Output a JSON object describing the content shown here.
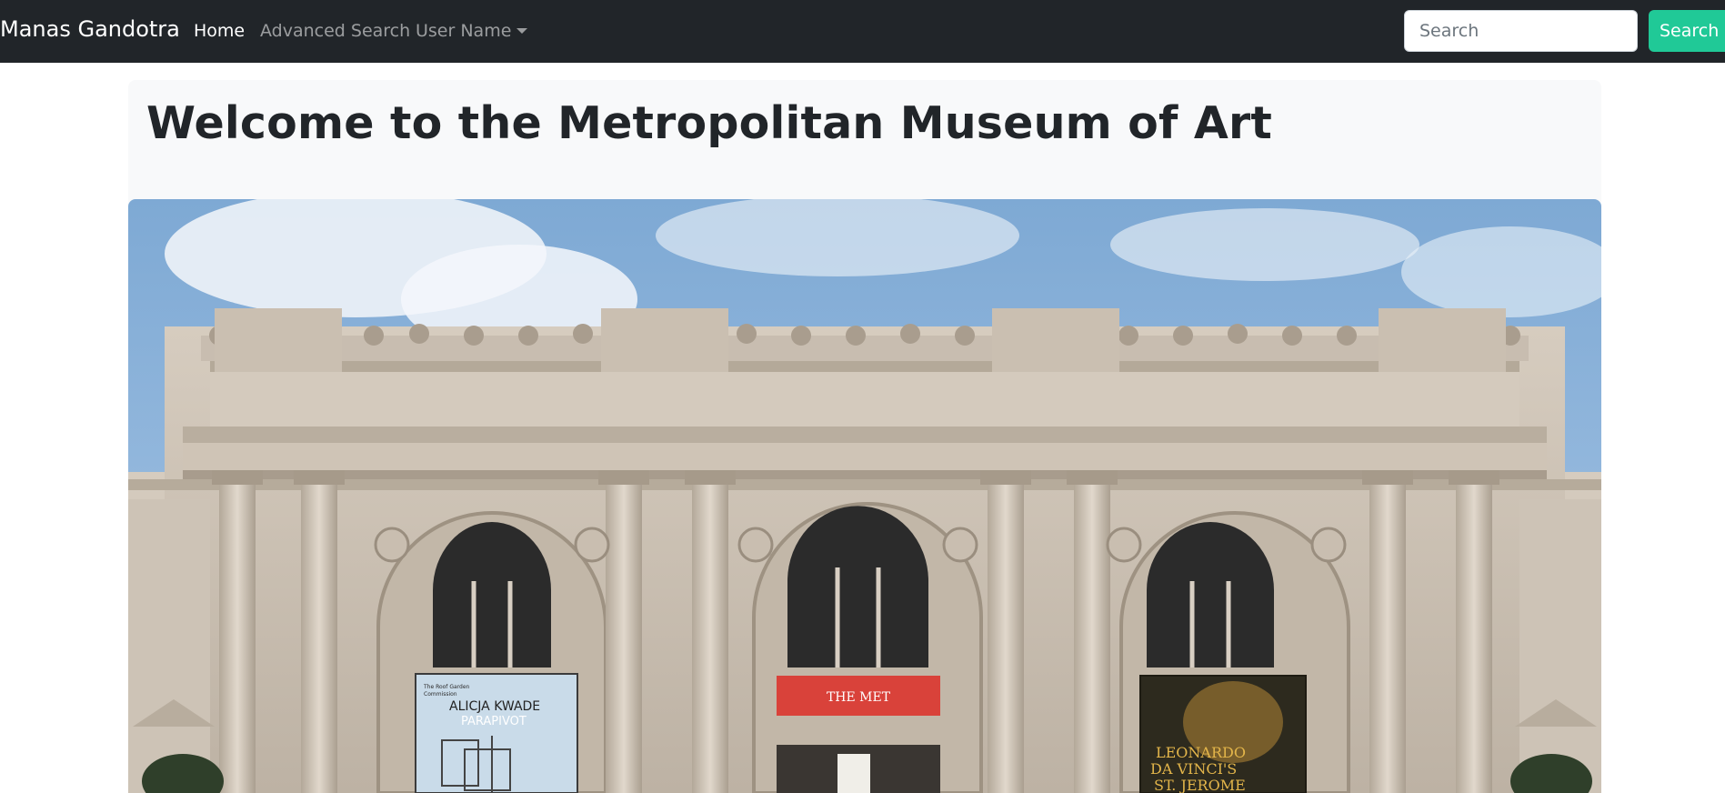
{
  "navbar": {
    "brand": "Manas Gandotra",
    "links": [
      {
        "label": "Home",
        "active": true
      },
      {
        "label": "Advanced Search",
        "active": false
      },
      {
        "label": "User Name",
        "active": false,
        "dropdown": true
      }
    ],
    "search": {
      "placeholder": "Search",
      "value": ""
    },
    "search_button": "Search",
    "colors": {
      "background": "#212529",
      "button": "#20c997"
    }
  },
  "main": {
    "title": "Welcome to the Metropolitan Museum of Art",
    "hero_image": {
      "description_icon": "museum-facade-image",
      "banners": [
        {
          "line1": "The Roof Garden",
          "line2": "Commission",
          "title": "ALICJA KWADE",
          "subtitle": "PARAPIVOT"
        },
        {
          "title": "THE MET"
        },
        {
          "title1": "LEONARDO",
          "title2": "DA VINCI'S",
          "title3": "ST. JEROME"
        }
      ]
    }
  }
}
